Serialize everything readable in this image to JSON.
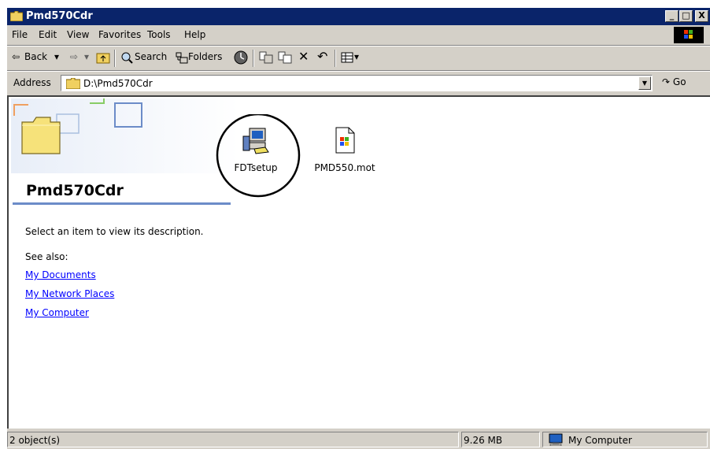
{
  "window": {
    "title": "Pmd570Cdr",
    "min_glyph": "_",
    "max_glyph": "□",
    "close_glyph": "X"
  },
  "menu": {
    "items": [
      "File",
      "Edit",
      "View",
      "Favorites",
      "Tools",
      "Help"
    ]
  },
  "toolbar": {
    "back_label": "Back",
    "back_arrow": "⇦",
    "back_dropdown": "▾",
    "forward_arrow": "⇨",
    "forward_dropdown": "▾",
    "search_label": "Search",
    "folders_label": "Folders",
    "delete_glyph": "✕",
    "undo_glyph": "↶",
    "views_dropdown": "▾"
  },
  "address": {
    "label": "Address",
    "value": "D:\\Pmd570Cdr",
    "dropdown_glyph": "▼",
    "go_label": "Go",
    "go_arrow": "↷"
  },
  "left_pane": {
    "folder_title": "Pmd570Cdr",
    "description": "Select an item to view its description.",
    "see_also": "See also:",
    "links": [
      "My Documents",
      "My Network Places",
      "My Computer"
    ]
  },
  "files": [
    {
      "name": "FDTsetup",
      "icon": "setup-computer-icon",
      "circled": true
    },
    {
      "name": "PMD550.mot",
      "icon": "document-icon",
      "circled": false
    }
  ],
  "status": {
    "objects": "2 object(s)",
    "size": "9.26 MB",
    "zone": "My Computer"
  },
  "colors": {
    "title_bar": "#0a246a",
    "link": "#0000ff",
    "chrome": "#d4d0c8",
    "accent_line": "#6c8cc8"
  }
}
